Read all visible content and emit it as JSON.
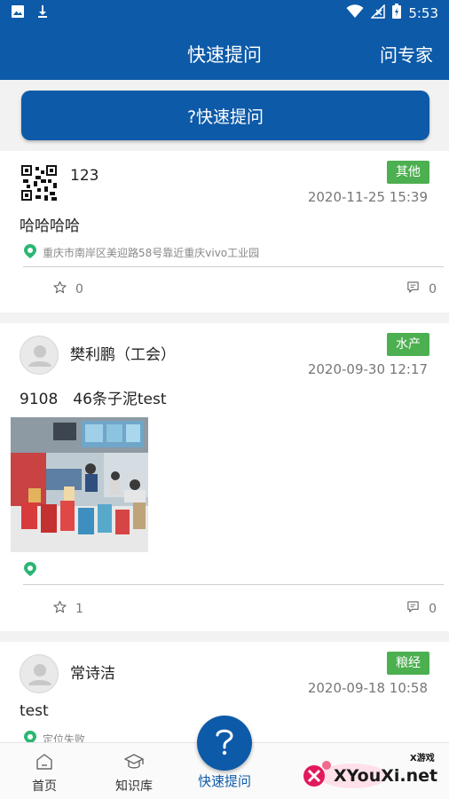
{
  "status_bar": {
    "time": "5:53"
  },
  "app_bar": {
    "title": "快速提问",
    "action": "问专家"
  },
  "ask_button": {
    "label": "?快速提问"
  },
  "posts": [
    {
      "user": "123",
      "category": "其他",
      "time": "2020-11-25 15:39",
      "content": "哈哈哈哈",
      "location": "重庆市南岸区美迎路58号靠近重庆vivo工业园",
      "likes": "0",
      "comments": "0"
    },
    {
      "user": "樊利鹏（工会）",
      "category": "水产",
      "time": "2020-09-30 12:17",
      "content": "9108　46条子泥test",
      "location": "",
      "likes": "1",
      "comments": "0"
    },
    {
      "user": "常诗洁",
      "category": "粮经",
      "time": "2020-09-18 10:58",
      "content": "test",
      "location": "定位失败"
    }
  ],
  "tabs": [
    {
      "label": "首页",
      "icon": "home-icon"
    },
    {
      "label": "知识库",
      "icon": "mortarboard-icon"
    },
    {
      "label": "快速提问",
      "icon": "question-icon"
    }
  ],
  "watermark": {
    "brand": "XYouXi.net",
    "sub": "X游戏"
  },
  "colors": {
    "primary": "#0d5aa8",
    "tag_green": "#4caf50",
    "location_green": "#2bb673"
  }
}
